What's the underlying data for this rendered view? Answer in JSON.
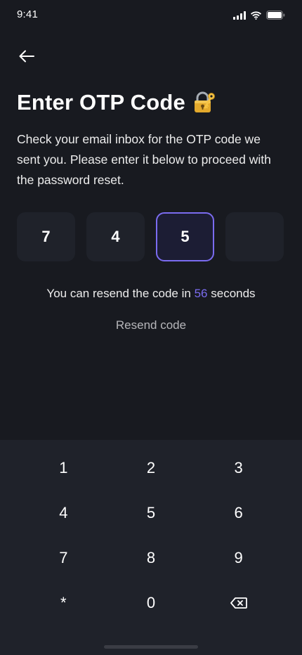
{
  "status_bar": {
    "time": "9:41"
  },
  "header": {
    "title": "Enter OTP Code"
  },
  "description": "Check your email inbox for the OTP code we sent you. Please enter it below to proceed with the password reset.",
  "otp": {
    "digits": [
      "7",
      "4",
      "5",
      ""
    ],
    "active_index": 2
  },
  "resend": {
    "info_prefix": "You can resend the code in",
    "seconds": "56",
    "info_suffix": "seconds",
    "button_label": "Resend code"
  },
  "keypad": {
    "keys": [
      "1",
      "2",
      "3",
      "4",
      "5",
      "6",
      "7",
      "8",
      "9",
      "*",
      "0"
    ],
    "backspace_icon": "backspace-icon"
  },
  "colors": {
    "background": "#181A20",
    "surface": "#1F222A",
    "accent": "#7B6CF0"
  }
}
